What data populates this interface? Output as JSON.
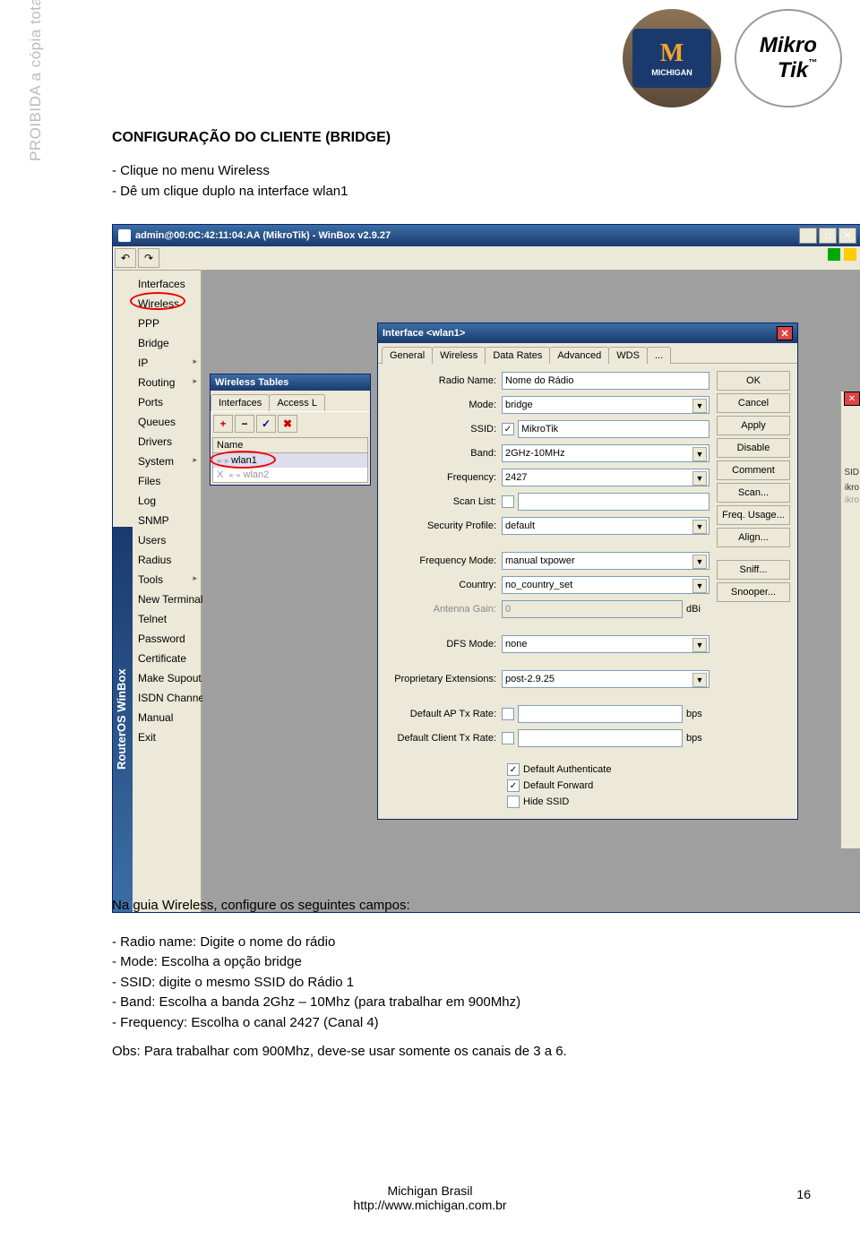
{
  "logos": {
    "michigan": "MICHIGAN",
    "michigan_m": "M",
    "mikrotik_line1": "Mikro",
    "mikrotik_line2": "Tik"
  },
  "watermark": "PROIBIDA a cópia total ou parcial deste guia exclusivo de referência, sem autorização do autor.",
  "doc": {
    "title": "CONFIGURAÇÃO DO CLIENTE (BRIDGE)",
    "step1": "- Clique no menu Wireless",
    "step2": "- Dê um clique duplo na interface wlan1",
    "config_intro": "Na guia Wireless, configure os seguintes campos:",
    "bullet1": "- Radio name: Digite o nome do rádio",
    "bullet2": "- Mode: Escolha a opção bridge",
    "bullet3": "- SSID: digite o mesmo SSID do Rádio 1",
    "bullet4": "- Band: Escolha a banda 2Ghz – 10Mhz (para trabalhar em 900Mhz)",
    "bullet5": "- Frequency: Escolha o canal 2427 (Canal 4)",
    "note": "Obs: Para trabalhar com 900Mhz, deve-se usar somente os canais de 3 a 6."
  },
  "winbox": {
    "title": "admin@00:0C:42:11:04:AA (MikroTik) - WinBox v2.9.27",
    "sidebar_logo": "RouterOS WinBox",
    "undo_symbol1": "↶",
    "undo_symbol2": "↷",
    "menu": [
      "Interfaces",
      "Wireless",
      "PPP",
      "Bridge",
      "IP",
      "Routing",
      "Ports",
      "Queues",
      "Drivers",
      "System",
      "Files",
      "Log",
      "SNMP",
      "Users",
      "Radius",
      "Tools",
      "New Terminal",
      "Telnet",
      "Password",
      "Certificate",
      "Make Supout.rif",
      "ISDN Channels",
      "Manual",
      "Exit"
    ]
  },
  "wireless_tables": {
    "title": "Wireless Tables",
    "tabs": [
      "Interfaces",
      "Access L"
    ],
    "toolbar": [
      "+",
      "−",
      "✓",
      "✖"
    ],
    "header": "Name",
    "rows": [
      "wlan1",
      "wlan2"
    ],
    "row_prefix": "«·»",
    "row2_x": "X"
  },
  "interface_win": {
    "title": "Interface <wlan1>",
    "tabs": [
      "General",
      "Wireless",
      "Data Rates",
      "Advanced",
      "WDS",
      "..."
    ],
    "fields": {
      "radio_name": {
        "label": "Radio Name:",
        "value": "Nome do Rádio"
      },
      "mode": {
        "label": "Mode:",
        "value": "bridge"
      },
      "ssid": {
        "label": "SSID:",
        "value": "MikroTik",
        "checked": "✓"
      },
      "band": {
        "label": "Band:",
        "value": "2GHz-10MHz"
      },
      "frequency": {
        "label": "Frequency:",
        "value": "2427"
      },
      "scan_list": {
        "label": "Scan List:",
        "value": ""
      },
      "security_profile": {
        "label": "Security Profile:",
        "value": "default"
      },
      "frequency_mode": {
        "label": "Frequency Mode:",
        "value": "manual txpower"
      },
      "country": {
        "label": "Country:",
        "value": "no_country_set"
      },
      "antenna_gain": {
        "label": "Antenna Gain:",
        "value": "0",
        "unit": "dBi"
      },
      "dfs_mode": {
        "label": "DFS Mode:",
        "value": "none"
      },
      "proprietary": {
        "label": "Proprietary Extensions:",
        "value": "post-2.9.25"
      },
      "default_ap": {
        "label": "Default AP Tx Rate:",
        "value": "",
        "unit": "bps"
      },
      "default_client": {
        "label": "Default Client Tx Rate:",
        "value": "",
        "unit": "bps"
      }
    },
    "checks": {
      "default_auth": {
        "label": "Default Authenticate",
        "checked": "✓"
      },
      "default_fwd": {
        "label": "Default Forward",
        "checked": "✓"
      },
      "hide_ssid": {
        "label": "Hide SSID",
        "checked": ""
      }
    },
    "buttons": [
      "OK",
      "Cancel",
      "Apply",
      "Disable",
      "Comment",
      "Scan...",
      "Freq. Usage...",
      "Align...",
      "Sniff...",
      "Snooper..."
    ]
  },
  "right_strip": {
    "sid": "SID",
    "ikro1": "ikro",
    "ikro2": "ikro"
  },
  "footer": {
    "org": "Michigan Brasil",
    "url": "http://www.michigan.com.br",
    "page": "16"
  }
}
